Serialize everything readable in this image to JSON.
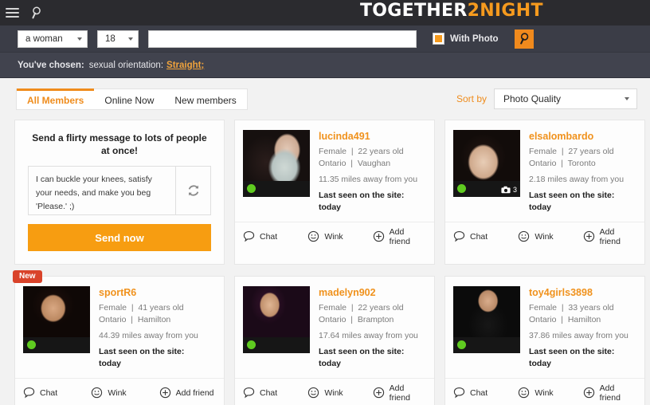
{
  "header": {
    "menu_icon": "hamburger-menu-icon",
    "search_icon": "magnifier-icon",
    "logo_white": "TOGETHER",
    "logo_orange": "2NIGHT"
  },
  "search": {
    "gender_value": "a woman",
    "age_value": "18",
    "keyword_value": "",
    "keyword_placeholder": "",
    "with_photo_label": "With Photo",
    "with_photo_checked": true,
    "search_button_icon": "magnifier-icon"
  },
  "chosen": {
    "prefix": "You've chosen:",
    "criterion": "sexual orientation:",
    "value": "Straight;"
  },
  "toolbar": {
    "tabs": [
      {
        "label": "All Members",
        "active": true
      },
      {
        "label": "Online Now",
        "active": false
      },
      {
        "label": "New members",
        "active": false
      }
    ],
    "sort_label": "Sort by",
    "sort_value": "Photo Quality"
  },
  "flirty_card": {
    "title": "Send a flirty message to lots of people at once!",
    "message": "I can buckle your knees, satisfy your needs, and make you beg 'Please.' ;)",
    "refresh_icon": "refresh-icon",
    "send_label": "Send now"
  },
  "actions": {
    "chat": "Chat",
    "wink": "Wink",
    "add_friend": "Add friend"
  },
  "profiles": [
    {
      "username": "lucinda491",
      "gender": "Female",
      "age": "22 years old",
      "region": "Ontario",
      "city": "Vaughan",
      "distance": "11.35 miles away from you",
      "last_seen_label": "Last seen on the site:",
      "last_seen_value": "today",
      "online": true,
      "photo_count": null,
      "new_badge": null
    },
    {
      "username": "elsalombardo",
      "gender": "Female",
      "age": "27 years old",
      "region": "Ontario",
      "city": "Toronto",
      "distance": "2.18 miles away from you",
      "last_seen_label": "Last seen on the site:",
      "last_seen_value": "today",
      "online": true,
      "photo_count": "3",
      "new_badge": null
    },
    {
      "username": "sportR6",
      "gender": "Female",
      "age": "41 years old",
      "region": "Ontario",
      "city": "Hamilton",
      "distance": "44.39 miles away from you",
      "last_seen_label": "Last seen on the site:",
      "last_seen_value": "today",
      "online": true,
      "photo_count": null,
      "new_badge": "New"
    },
    {
      "username": "madelyn902",
      "gender": "Female",
      "age": "22 years old",
      "region": "Ontario",
      "city": "Brampton",
      "distance": "17.64 miles away from you",
      "last_seen_label": "Last seen on the site:",
      "last_seen_value": "today",
      "online": true,
      "photo_count": null,
      "new_badge": null
    },
    {
      "username": "toy4girls3898",
      "gender": "Female",
      "age": "33 years old",
      "region": "Ontario",
      "city": "Hamilton",
      "distance": "37.86 miles away from you",
      "last_seen_label": "Last seen on the site:",
      "last_seen_value": "today",
      "online": true,
      "photo_count": null,
      "new_badge": null
    }
  ],
  "colors": {
    "accent_orange": "#f0921d",
    "header_dark": "#2b2b2f",
    "searchbar_dark": "#3b3d47",
    "chosenbar_dark": "#41434e",
    "send_orange": "#f79d11",
    "badge_red": "#d9432a",
    "online_green": "#5fcb20"
  }
}
